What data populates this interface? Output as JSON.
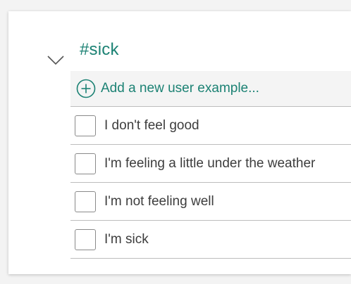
{
  "intent": {
    "title": "#sick",
    "expand_icon": "chevron-down-icon"
  },
  "add_example": {
    "icon": "add-circle-icon",
    "label": "Add a new user example..."
  },
  "examples": [
    {
      "text": "I don't feel good",
      "checked": false
    },
    {
      "text": "I'm feeling a little under the weather",
      "checked": false
    },
    {
      "text": "I'm not feeling well",
      "checked": false
    },
    {
      "text": "I'm sick",
      "checked": false
    }
  ],
  "colors": {
    "accent": "#1c8274",
    "text": "#3d3d3d",
    "divider": "#bdbdbd",
    "add_row_bg": "#f4f4f4"
  }
}
